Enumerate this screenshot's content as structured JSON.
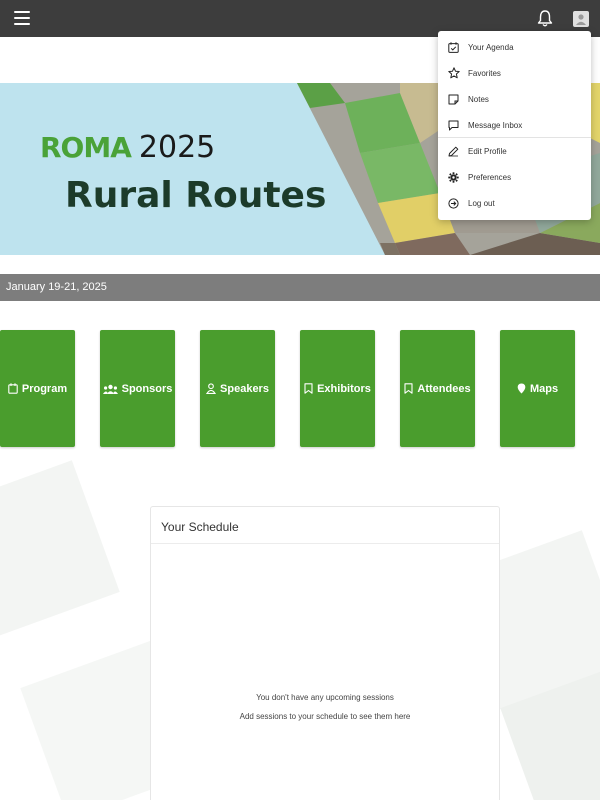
{
  "header": {
    "menu_icon": "hamburger-icon",
    "notifications_icon": "bell-icon",
    "profile_icon": "user-avatar-icon"
  },
  "banner": {
    "logo_text": "ROMA",
    "year": "2025",
    "title": "Rural Routes"
  },
  "event": {
    "dates": "January 19-21, 2025"
  },
  "tiles": [
    {
      "label": "Program",
      "icon": "calendar-icon"
    },
    {
      "label": "Sponsors",
      "icon": "people-icon"
    },
    {
      "label": "Speakers",
      "icon": "person-icon"
    },
    {
      "label": "Exhibitors",
      "icon": "bookmark-icon"
    },
    {
      "label": "Attendees",
      "icon": "bookmark-icon"
    },
    {
      "label": "Maps",
      "icon": "map-pin-icon"
    }
  ],
  "schedule": {
    "title": "Your Schedule",
    "empty_message": "You don't have any upcoming sessions",
    "empty_hint": "Add sessions to your schedule to see them here"
  },
  "user_menu": {
    "items": [
      {
        "label": "Your Agenda",
        "icon": "calendar-check-icon"
      },
      {
        "label": "Favorites",
        "icon": "star-icon"
      },
      {
        "label": "Notes",
        "icon": "note-icon"
      },
      {
        "label": "Message Inbox",
        "icon": "message-icon"
      },
      {
        "label": "Edit Profile",
        "icon": "pencil-icon"
      },
      {
        "label": "Preferences",
        "icon": "gear-icon"
      },
      {
        "label": "Log out",
        "icon": "logout-icon"
      }
    ]
  },
  "colors": {
    "topbar": "#3d3d3d",
    "tile_green": "#4a9d2d",
    "banner_sky": "#bee3ee",
    "date_bar": "#7d7d7d"
  }
}
